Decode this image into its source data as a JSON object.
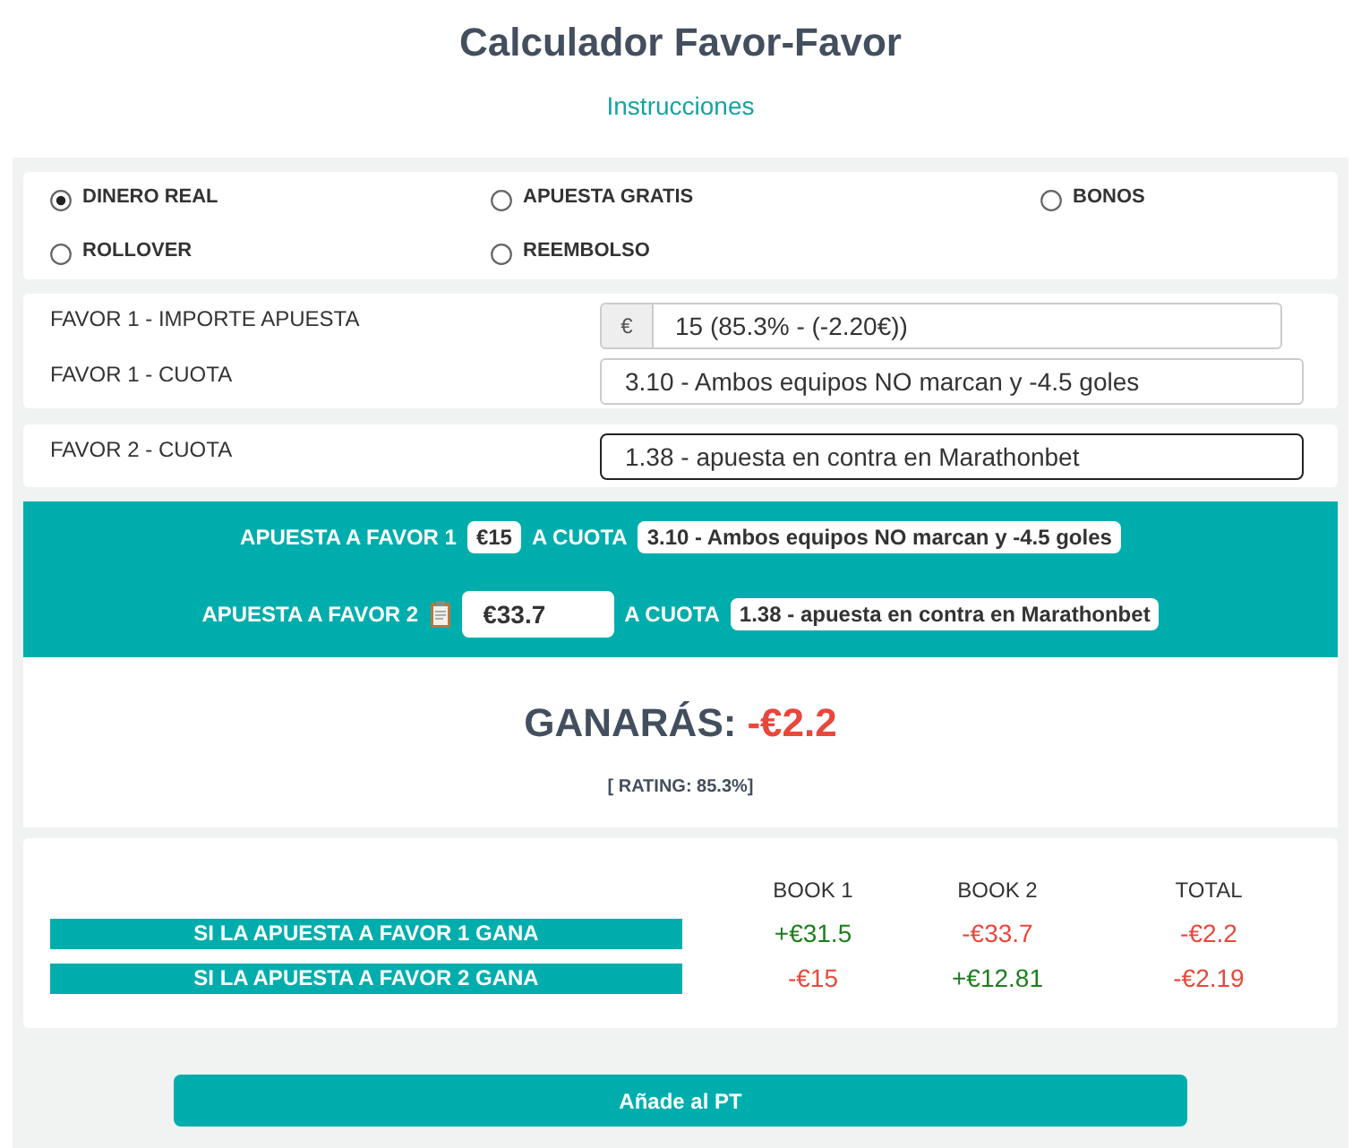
{
  "title": "Calculador Favor-Favor",
  "instructions_link": "Instrucciones",
  "bet_types": [
    {
      "label": "DINERO REAL",
      "selected": true
    },
    {
      "label": "APUESTA GRATIS",
      "selected": false
    },
    {
      "label": "BONOS",
      "selected": false
    },
    {
      "label": "ROLLOVER",
      "selected": false
    },
    {
      "label": "REEMBOLSO",
      "selected": false
    }
  ],
  "input_groups": [
    {
      "fields": [
        {
          "label": "FAVOR 1 - IMPORTE APUESTA",
          "prefix": "€",
          "value": "15 (85.3% - (-2.20€))",
          "focused": false
        },
        {
          "label": "FAVOR 1 - CUOTA",
          "value": "3.10 - Ambos equipos NO marcan y -4.5 goles",
          "focused": false
        }
      ]
    },
    {
      "fields": [
        {
          "label": "FAVOR 2 - CUOTA",
          "value": "1.38 - apuesta en contra en Marathonbet",
          "focused": true
        }
      ]
    }
  ],
  "bet_summary": [
    {
      "kind": "badge",
      "label": "APUESTA A FAVOR 1",
      "stake": "€15",
      "odds_label": "A CUOTA",
      "odds": "3.10 - Ambos equipos NO marcan y -4.5 goles"
    },
    {
      "kind": "input",
      "label": "APUESTA A FAVOR 2",
      "stake": "€33.7",
      "odds_label": "A CUOTA",
      "odds": "1.38 - apuesta en contra en Marathonbet"
    }
  ],
  "result": {
    "label": "GANARÁS:",
    "value": "-€2.2",
    "rating": "[ RATING: 85.3%]"
  },
  "breakdown": {
    "columns": [
      "BOOK 1",
      "BOOK 2",
      "TOTAL"
    ],
    "rows": [
      {
        "label": "SI LA APUESTA A FAVOR 1 GANA",
        "cells": [
          {
            "text": "+€31.5",
            "color": "#1b7e1b"
          },
          {
            "text": "-€33.7",
            "color": "#e8473b"
          },
          {
            "text": "-€2.2",
            "color": "#e8473b"
          }
        ]
      },
      {
        "label": "SI LA APUESTA A FAVOR 2 GANA",
        "cells": [
          {
            "text": "-€15",
            "color": "#e8473b"
          },
          {
            "text": "+€12.81",
            "color": "#1b7e1b"
          },
          {
            "text": "-€2.19",
            "color": "#e8473b"
          }
        ]
      }
    ]
  },
  "add_button": "Añade al PT"
}
